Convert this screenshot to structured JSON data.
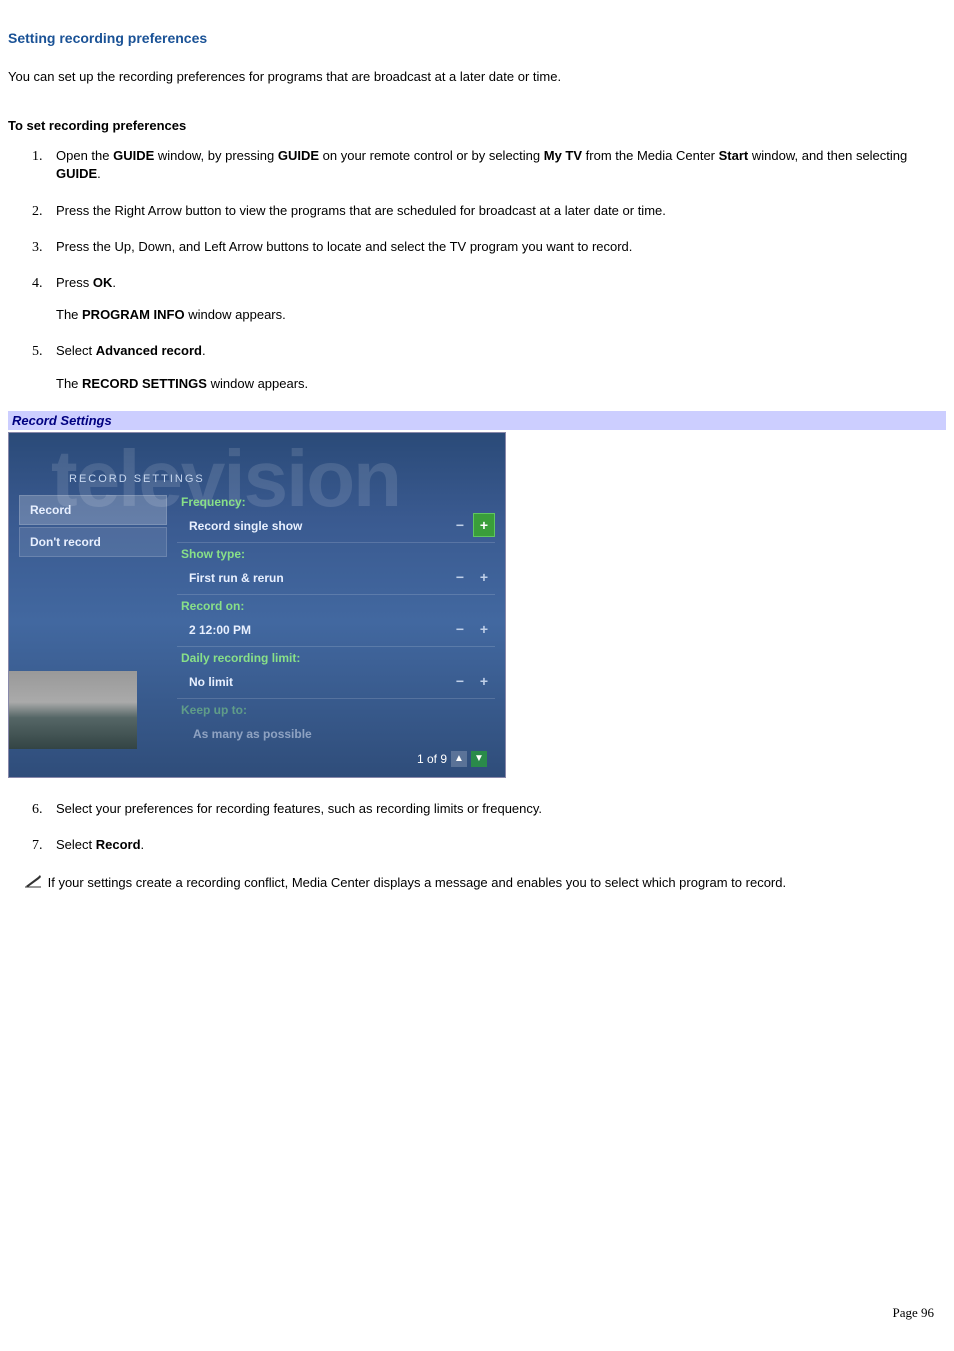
{
  "title": "Setting recording preferences",
  "intro": "You can set up the recording preferences for programs that are broadcast at a later date or time.",
  "sub_heading": "To set recording preferences",
  "steps": {
    "s1": {
      "pre1": "Open the ",
      "b1": "GUIDE",
      "mid1": " window, by pressing ",
      "b2": "GUIDE",
      "mid2": " on your remote control or by selecting ",
      "b3": "My TV",
      "mid3": " from the Media Center ",
      "b4": "Start",
      "mid4": " window, and then selecting ",
      "b5": "GUIDE",
      "end": "."
    },
    "s2": "Press the Right Arrow button to view the programs that are scheduled for broadcast at a later date or time.",
    "s3": "Press the Up, Down, and Left Arrow buttons to locate and select the TV program you want to record.",
    "s4_pre": "Press ",
    "s4_b": "OK",
    "s4_end": ".",
    "s4_p_pre": "The ",
    "s4_p_b": "PROGRAM INFO",
    "s4_p_end": " window appears.",
    "s5_pre": "Select ",
    "s5_b": "Advanced record",
    "s5_end": ".",
    "s5_p_pre": "The ",
    "s5_p_b": "RECORD SETTINGS",
    "s5_p_end": " window appears.",
    "s6": "Select your preferences for recording features, such as recording limits or frequency.",
    "s7_pre": "Select ",
    "s7_b": "Record",
    "s7_end": "."
  },
  "caption": "Record Settings",
  "shot": {
    "bg_text": "television",
    "header": "RECORD SETTINGS",
    "left": {
      "record": "Record",
      "dont": "Don't record"
    },
    "rows": [
      {
        "label": "Frequency:",
        "value": "Record single show",
        "active": true
      },
      {
        "label": "Show type:",
        "value": "First run & rerun",
        "active": false
      },
      {
        "label": "Record on:",
        "value": "2  12:00 PM",
        "active": false
      },
      {
        "label": "Daily recording limit:",
        "value": "No limit",
        "active": false
      },
      {
        "label": "Keep up to:",
        "value": "As many as possible",
        "active": false,
        "dim": true
      }
    ],
    "footer": "1 of 9"
  },
  "note": " If your settings create a recording conflict, Media Center displays a message and enables you to select which program to record.",
  "page_num": "Page 96"
}
